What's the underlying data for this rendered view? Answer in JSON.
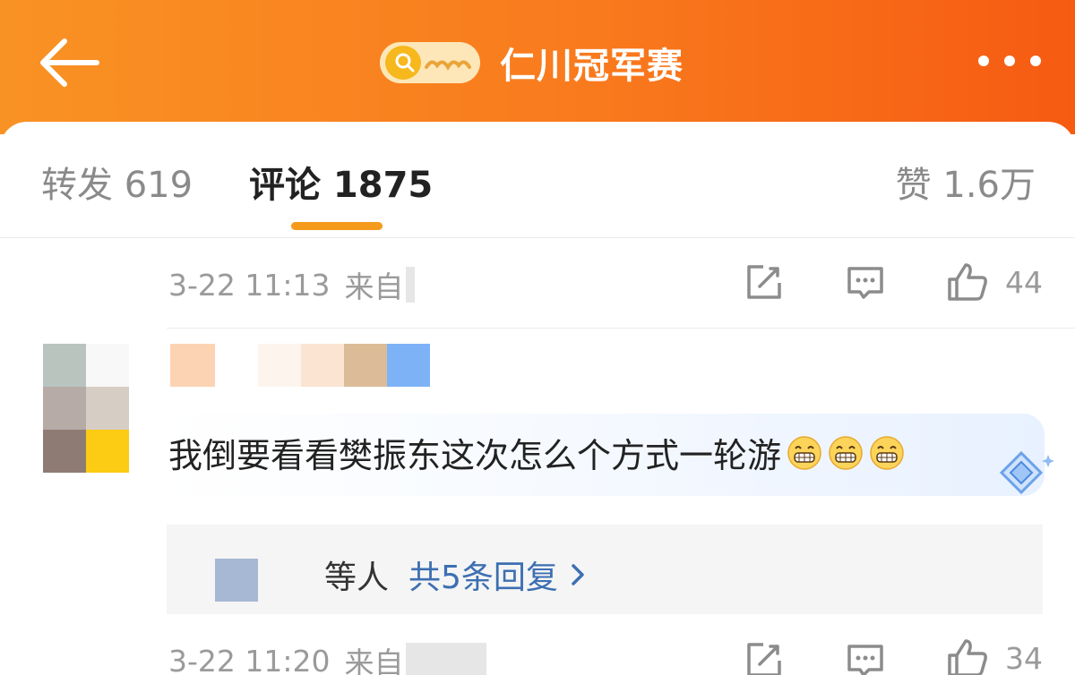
{
  "header": {
    "back_icon": "arrow-left-icon",
    "topic_icon": "hot-topic-search-icon",
    "title": "仁川冠军赛",
    "more_icon": "more-dots-icon",
    "colors": {
      "start": "#f99224",
      "end": "#f65b12"
    }
  },
  "tabs": {
    "forward": "转发 619",
    "comments": "评论 1875",
    "likes": "赞 1.6万",
    "active_color": "#f59a1b"
  },
  "comments": [
    {
      "timestamp": "3-22 11:13",
      "source_prefix": "来自",
      "like_count": "44"
    },
    {
      "text": "我倒要看看樊振东这次怎么个方式一轮游",
      "emoji": [
        "grinning-emoji",
        "grinning-emoji",
        "grinning-emoji"
      ],
      "badge_icon": "diamond-badge-icon",
      "replies": {
        "who_suffix": "等人",
        "link": "共5条回复"
      }
    },
    {
      "timestamp": "3-22 11:20",
      "source_prefix": "来自",
      "like_count": "34"
    }
  ]
}
